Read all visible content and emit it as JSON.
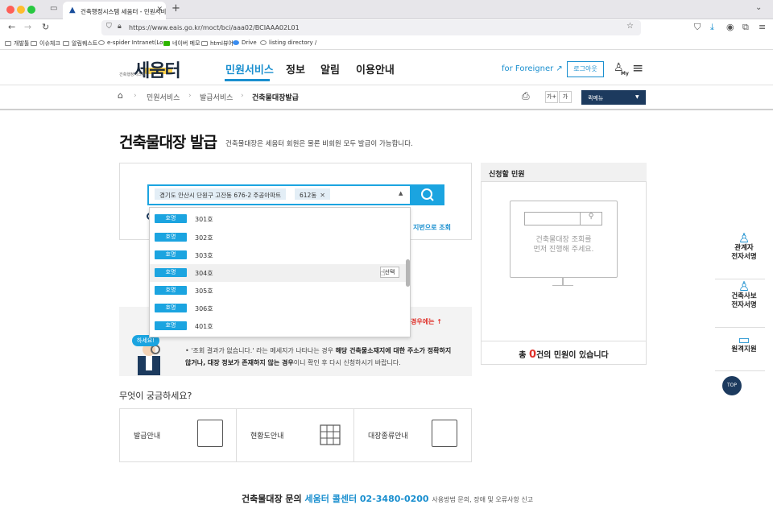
{
  "browser": {
    "tab_title": "건축행정시스템 세움터 - 민원서비스...",
    "url": "https://www.eais.go.kr/moct/bci/aaa02/BCIAAA02L01",
    "bookmarks": [
      "개발툴",
      "이슈체크",
      "알림퀘스트",
      "e-spider Intranet(Lo...",
      "네이버 메모",
      "html뷰어",
      "Drive",
      "listing directory /"
    ]
  },
  "header": {
    "logo_text": "세움터",
    "logo_sub": "건축행정시스템",
    "nav": [
      "민원서비스",
      "정보",
      "알림",
      "이용안내"
    ],
    "for_foreigner": "for Foreigner",
    "logout": "로그아웃",
    "my_label": "My"
  },
  "breadcrumb": {
    "items": [
      "민원서비스",
      "발급서비스",
      "건축물대장발급"
    ],
    "font_plus": "가+",
    "font_minus": "가",
    "quick_menu": "퀵메뉴"
  },
  "page": {
    "title": "건축물대장 발급",
    "subtitle": "건축물대장은 세움터 회원은 물론 비회원 모두 발급이 가능합니다."
  },
  "search": {
    "chip_address": "경기도 안산시 단원구 고잔동 676-2 주공아파트",
    "chip_dong": "612동",
    "lot_link": "지번으로 조회"
  },
  "dropdown": {
    "badge": "호명",
    "select_label": "선택",
    "items": [
      "301호",
      "302호",
      "303호",
      "304호",
      "305호",
      "306호",
      "401호"
    ],
    "hover_index": 3
  },
  "notice": {
    "red_text": "경우에는 ↑",
    "help_badge": "하세요!",
    "line1_a": "• '조회 결과가 없습니다.' 라는 메세지가 나타나는 경우 ",
    "line1_b": "해당 건축물소재지에 대한 주소가 정확하지",
    "line2_a": "않거나, 대장 정보가 존재하지 않는 경우",
    "line2_b": "이니 확인 후 다시 신청하시기 바랍니다."
  },
  "panel": {
    "title": "신청할 민원",
    "monitor_text": "건축물대장 조회를\n먼저 진행해 주세요.",
    "count_prefix": "총 ",
    "count": "0",
    "count_suffix": "건의 민원이 있습니다"
  },
  "faq": {
    "title": "무엇이 궁금하세요?",
    "items": [
      "발급안내",
      "현황도안내",
      "대장종류안내"
    ]
  },
  "footer": {
    "prefix": "건축물대장 문의",
    "call": "세움터 콜센터 02-3480-0200",
    "suffix": "사용방법 문의, 장애 및 오류사항 신고"
  },
  "quick_side": {
    "items": [
      "관계자\n전자서명",
      "건축사보\n전자서명",
      "원격지원"
    ],
    "top": "TOP"
  },
  "colors": {
    "accent": "#1ba4e0",
    "navy": "#1c3a5e",
    "alert": "#e0322b"
  }
}
